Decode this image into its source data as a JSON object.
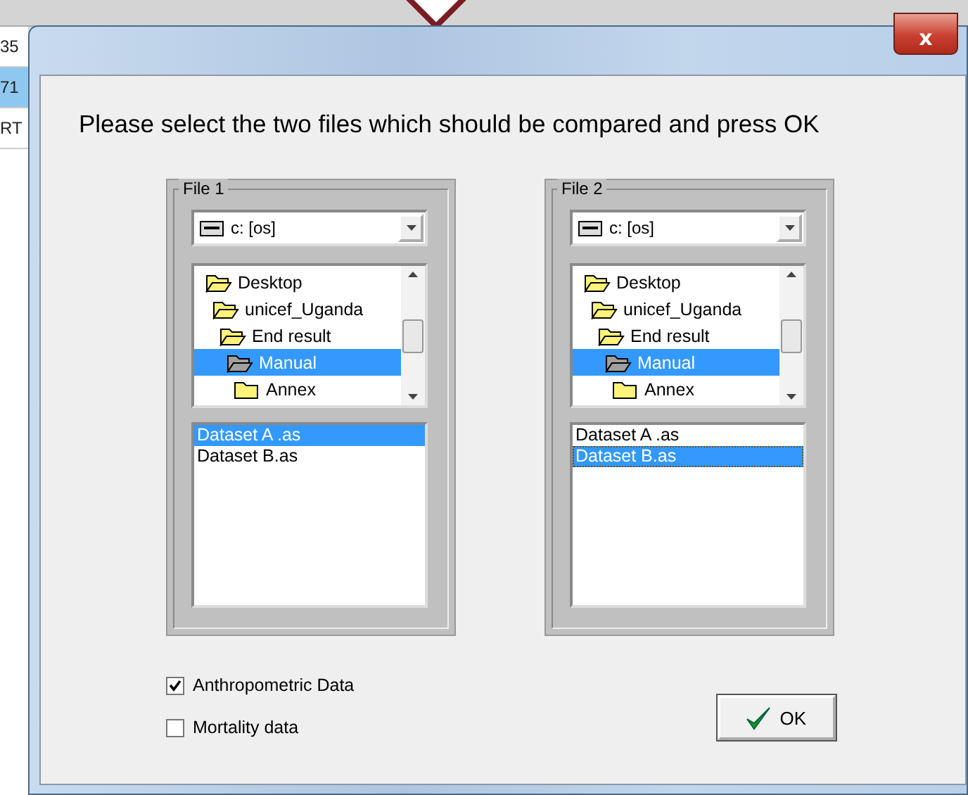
{
  "background": {
    "texts": [
      "35",
      "71",
      "RT"
    ]
  },
  "dialog": {
    "close_label": "x",
    "heading": "Please select the two files which should be compared and press OK",
    "file_groups": [
      {
        "legend": "File 1",
        "drive": "c: [os]",
        "tree": [
          {
            "label": "Desktop",
            "open": true,
            "selected": false,
            "children": [
              {
                "label": "unicef_Uganda",
                "open": true,
                "selected": false,
                "children": [
                  {
                    "label": "End result",
                    "open": true,
                    "selected": false,
                    "children": [
                      {
                        "label": "Manual",
                        "open": true,
                        "selected": true,
                        "children": [
                          {
                            "label": "Annex",
                            "open": false,
                            "selected": false
                          }
                        ]
                      }
                    ]
                  }
                ]
              }
            ]
          }
        ],
        "files": [
          {
            "label": "Dataset A .as",
            "selected": true,
            "focused": false
          },
          {
            "label": "Dataset B.as",
            "selected": false,
            "focused": false
          }
        ]
      },
      {
        "legend": "File 2",
        "drive": "c: [os]",
        "tree": [
          {
            "label": "Desktop",
            "open": true,
            "selected": false,
            "children": [
              {
                "label": "unicef_Uganda",
                "open": true,
                "selected": false,
                "children": [
                  {
                    "label": "End result",
                    "open": true,
                    "selected": false,
                    "children": [
                      {
                        "label": "Manual",
                        "open": true,
                        "selected": true,
                        "children": [
                          {
                            "label": "Annex",
                            "open": false,
                            "selected": false
                          }
                        ]
                      }
                    ]
                  }
                ]
              }
            ]
          }
        ],
        "files": [
          {
            "label": "Dataset A .as",
            "selected": false,
            "focused": false
          },
          {
            "label": "Dataset B.as",
            "selected": true,
            "focused": true
          }
        ]
      }
    ],
    "options": [
      {
        "label": "Anthropometric Data",
        "checked": true
      },
      {
        "label": "Mortality data",
        "checked": false
      }
    ],
    "ok_button": {
      "label": "OK"
    }
  }
}
